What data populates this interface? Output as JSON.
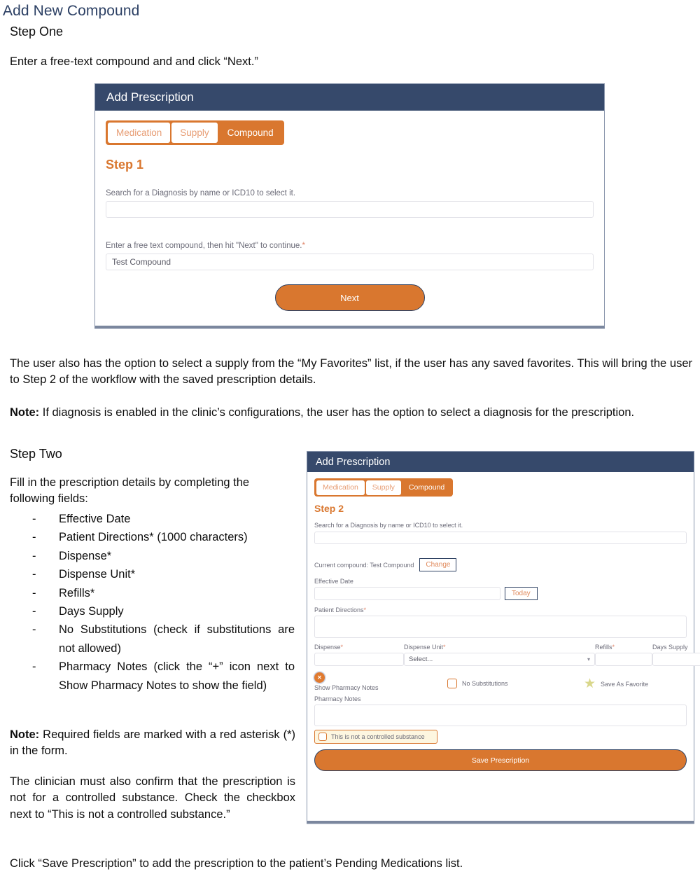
{
  "document": {
    "title": "Add New Compound",
    "step_one_heading": "Step One",
    "intro": "Enter a free-text compound and and click “Next.”",
    "favorites_paragraph": "The user also has the option to select a supply from the “My Favorites” list, if the user has any saved favorites. This will bring the user to Step 2 of the workflow with the saved prescription details.",
    "note_label": "Note:",
    "note_diagnosis": " If diagnosis is enabled in the clinic’s configurations, the user has the option to select a diagnosis for the prescription.",
    "step_two_heading": "Step Two",
    "fill_in_paragraph": "Fill in the prescription details by completing the following fields:",
    "field_bullet": "-",
    "fields": [
      "Effective Date",
      "Patient Directions* (1000 characters)",
      "Dispense*",
      "Dispense Unit*",
      "Refills*",
      "Days Supply",
      "No Substitutions (check if substitutions are not allowed)",
      "Pharmacy Notes (click the “+” icon next to Show Pharmacy Notes to show the field)"
    ],
    "note_required": " Required fields are marked with a red asterisk (*) in the form.",
    "clinician_paragraph": "The clinician must also confirm that the prescription is not for a controlled substance. Check the checkbox next to “This is not a controlled substance.”",
    "closing_paragraph": "Click “Save Prescription” to add the prescription to the patient’s Pending Medications list."
  },
  "panel_one": {
    "header_title": "Add Prescription",
    "tabs": [
      {
        "label": "Medication",
        "active": false
      },
      {
        "label": "Supply",
        "active": false
      },
      {
        "label": "Compound",
        "active": true
      }
    ],
    "step_title": "Step 1",
    "diagnosis_label": "Search for a Diagnosis by name or ICD10 to select it.",
    "diagnosis_value": "",
    "compound_label": "Enter a free text compound, then hit \"Next\" to continue.",
    "compound_required_mark": "*",
    "compound_value": "Test Compound",
    "next_button": "Next"
  },
  "panel_two": {
    "header_title": "Add Prescription",
    "tabs": [
      {
        "label": "Medication",
        "active": false
      },
      {
        "label": "Supply",
        "active": false
      },
      {
        "label": "Compound",
        "active": true
      }
    ],
    "step_title": "Step 2",
    "diagnosis_label": "Search for a Diagnosis by name or ICD10 to select it.",
    "diagnosis_value": "",
    "current_compound_label": "Current compound: Test Compound",
    "change_button": "Change",
    "effective_date_label": "Effective Date",
    "effective_date_value": "",
    "today_button": "Today",
    "patient_directions_label": "Patient Directions",
    "patient_directions_value": "",
    "dispense_label": "Dispense",
    "dispense_value": "",
    "dispense_unit_label": "Dispense Unit",
    "dispense_unit_value": "Select...",
    "refills_label": "Refills",
    "refills_value": "",
    "days_supply_label": "Days Supply",
    "days_supply_value": "",
    "required_mark": "*",
    "show_pharmacy_notes_label": "Show Pharmacy Notes",
    "toggle_icon_glyph": "✕",
    "no_substitutions_label": "No Substitutions",
    "save_as_favorite_label": "Save As Favorite",
    "star_glyph": "★",
    "pharmacy_notes_label": "Pharmacy Notes",
    "pharmacy_notes_value": "",
    "controlled_substance_label": "This is not a controlled substance",
    "save_button": "Save Prescription",
    "select_caret_glyph": "▾"
  },
  "colors": {
    "navy_header": "#36496b",
    "orange": "#d9772f",
    "title_blue": "#2b3f63",
    "cream": "#fdf6e0",
    "star": "#d9d78b"
  }
}
